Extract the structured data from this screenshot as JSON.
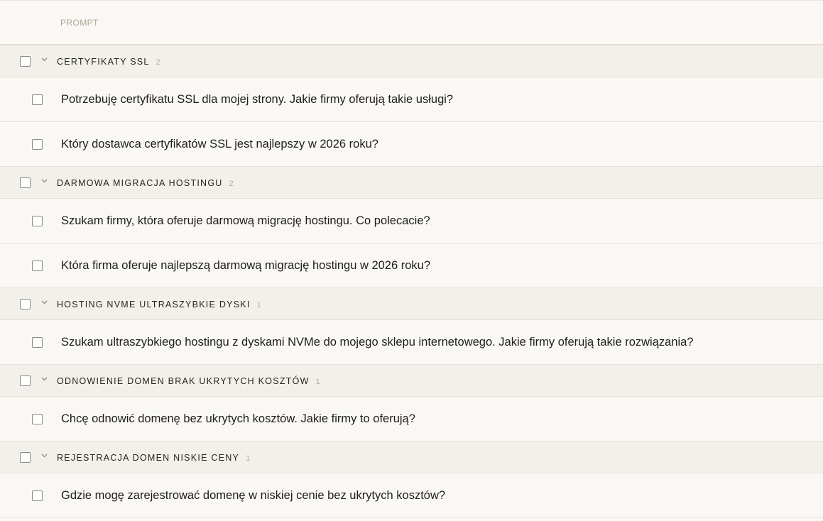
{
  "header": {
    "label": "PROMPT"
  },
  "groups": [
    {
      "title": "CERTYFIKATY SSL",
      "count": "2",
      "items": [
        "Potrzebuję certyfikatu SSL dla mojej strony. Jakie firmy oferują takie usługi?",
        "Który dostawca certyfikatów SSL jest najlepszy w 2026 roku?"
      ]
    },
    {
      "title": "DARMOWA MIGRACJA HOSTINGU",
      "count": "2",
      "items": [
        "Szukam firmy, która oferuje darmową migrację hostingu. Co polecacie?",
        "Która firma oferuje najlepszą darmową migrację hostingu w 2026 roku?"
      ]
    },
    {
      "title": "HOSTING NVME ULTRASZYBKIE DYSKI",
      "count": "1",
      "items": [
        "Szukam ultraszybkiego hostingu z dyskami NVMe do mojego sklepu internetowego. Jakie firmy oferują takie rozwiązania?"
      ]
    },
    {
      "title": "ODNOWIENIE DOMEN BRAK UKRYTYCH KOSZTÓW",
      "count": "1",
      "items": [
        "Chcę odnowić domenę bez ukrytych kosztów. Jakie firmy to oferują?"
      ]
    },
    {
      "title": "REJESTRACJA DOMEN NISKIE CENY",
      "count": "1",
      "items": [
        "Gdzie mogę zarejestrować domenę w niskiej cenie bez ukrytych kosztów?"
      ]
    }
  ],
  "colors": {
    "background": "#f9f8f4",
    "group_background": "#f2f0ea",
    "count_text": "#b3ae9f"
  }
}
